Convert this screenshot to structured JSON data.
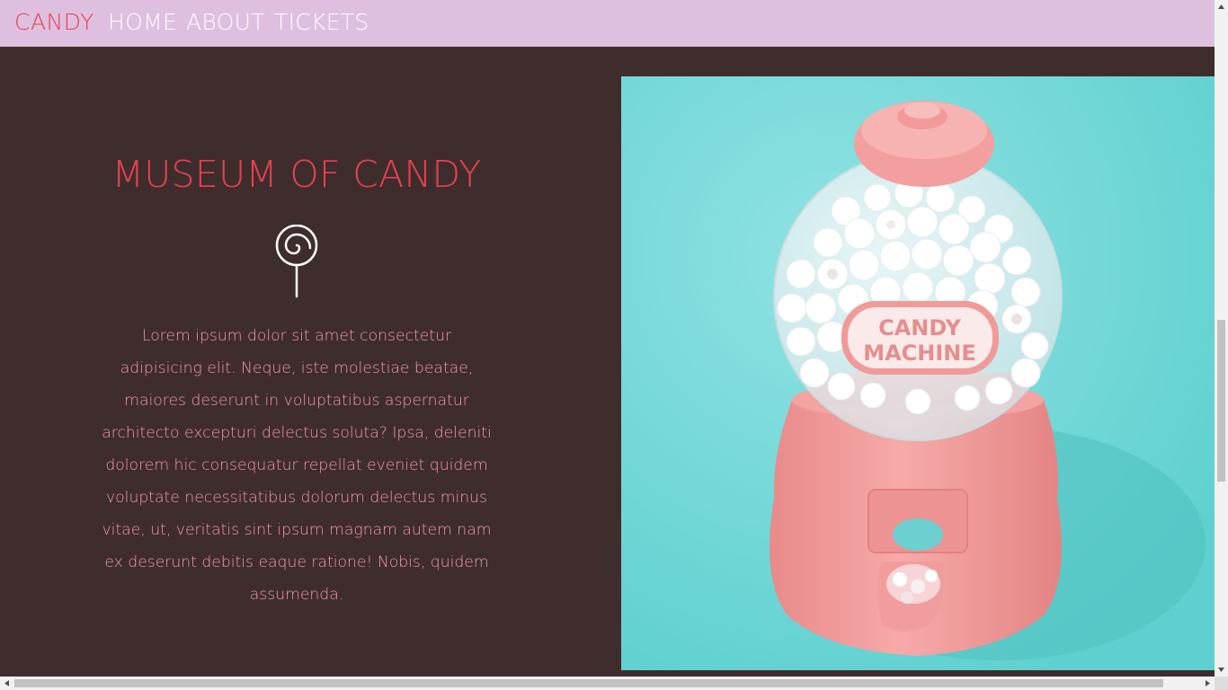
{
  "nav": {
    "brand": "CANDY",
    "links": [
      "HOME",
      "ABOUT",
      "TICKETS"
    ]
  },
  "hero": {
    "title": "MUSEUM OF CANDY",
    "icon": "lollipop-icon",
    "body": "Lorem ipsum dolor sit amet consectetur adipisicing elit. Neque, iste molestiae beatae, maiores deserunt in voluptatibus aspernatur architecto excepturi delectus soluta? Ipsa, deleniti dolorem hic consequatur repellat eveniet quidem voluptate necessitatibus dolorum delectus minus vitae, ut, veritatis sint ipsum magnam autem nam ex deserunt debitis eaque ratione! Nobis, quidem assumenda."
  },
  "photo": {
    "label_line1": "CANDY",
    "label_line2": "MACHINE"
  },
  "colors": {
    "nav_bg": "#dfbfdf",
    "brand": "#e8424f",
    "page_bg": "#3f2d2d",
    "title": "#e8424f",
    "body_text": "#f29aa0",
    "photo_bg": "#74d8d8",
    "machine_pink": "#f19a9a"
  }
}
